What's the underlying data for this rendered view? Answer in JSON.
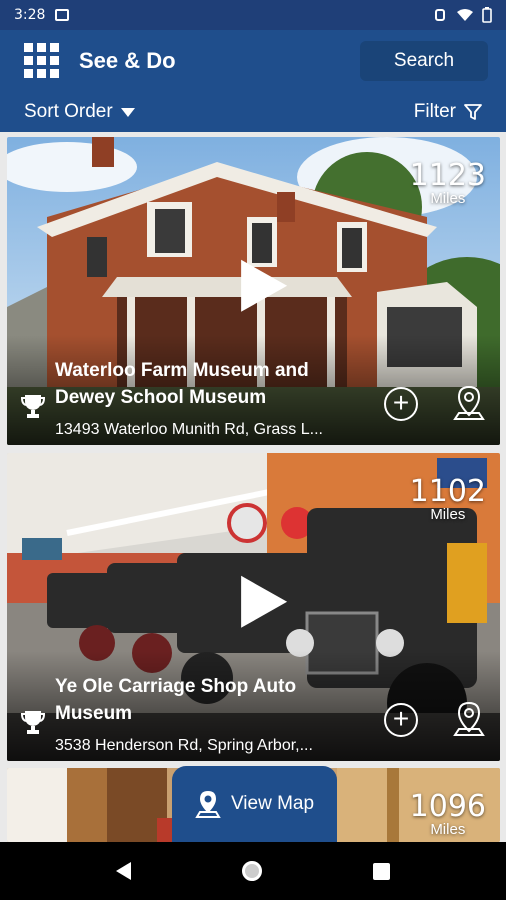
{
  "status_bar": {
    "time": "3:28"
  },
  "app_bar": {
    "title": "See & Do",
    "search_label": "Search"
  },
  "toolbar": {
    "sort_label": "Sort Order",
    "filter_label": "Filter"
  },
  "listings": [
    {
      "distance": "1123",
      "distance_unit": "Miles",
      "name": "Waterloo Farm Museum and Dewey School Museum",
      "address": "13493 Waterloo Munith Rd, Grass L..."
    },
    {
      "distance": "1102",
      "distance_unit": "Miles",
      "name": "Ye Ole Carriage Shop Auto Museum",
      "address": "3538 Henderson Rd, Spring Arbor,..."
    },
    {
      "distance": "1096",
      "distance_unit": "Miles",
      "name": "",
      "address": ""
    }
  ],
  "view_map": {
    "label": "View Map"
  },
  "colors": {
    "primary": "#1f4e8c",
    "status_bar": "#1f3f78"
  },
  "icons": [
    "menu-grid-icon",
    "sort-caret-icon",
    "filter-icon",
    "play-icon",
    "trophy-icon",
    "add-icon",
    "map-pin-icon",
    "back-icon",
    "home-icon",
    "recents-icon"
  ]
}
